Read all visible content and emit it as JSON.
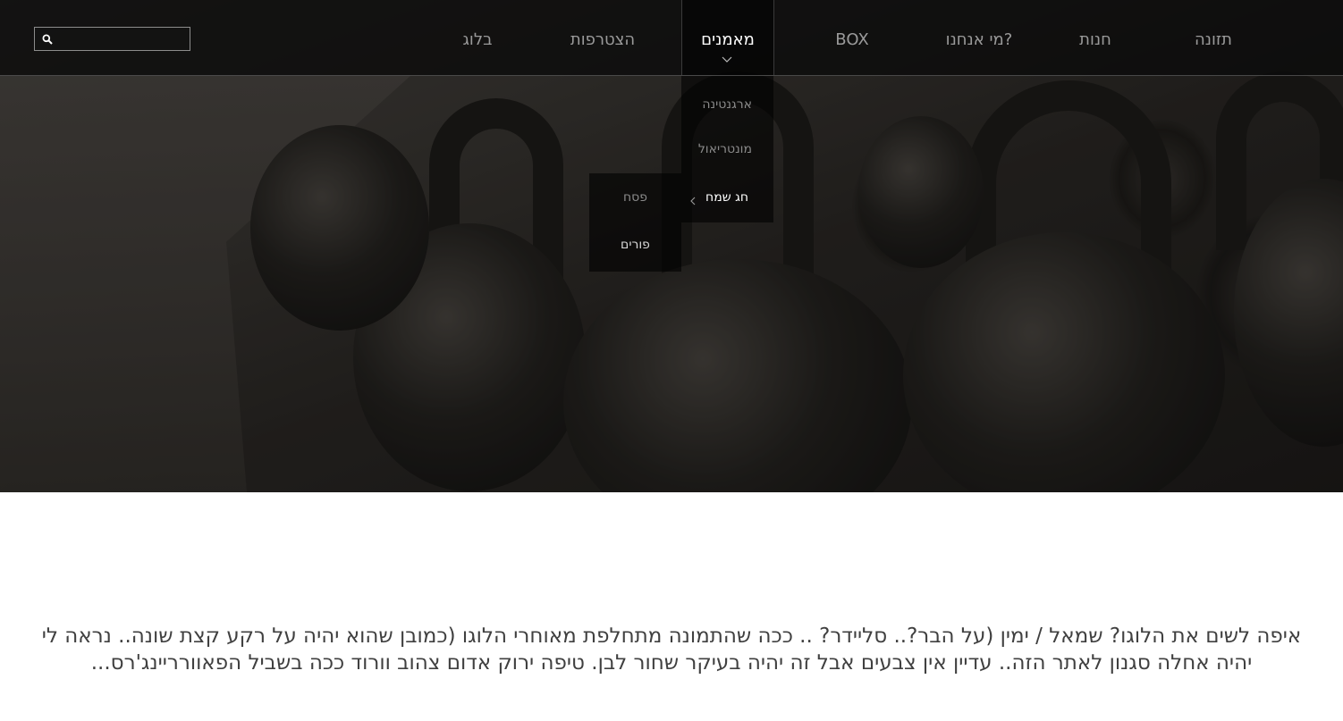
{
  "search": {
    "placeholder": ""
  },
  "nav": {
    "items": [
      {
        "label": "תזונה"
      },
      {
        "label": "חנות"
      },
      {
        "label": "מי אנחנו?"
      },
      {
        "label": "BOX"
      },
      {
        "label": "מאמנים",
        "active": true
      },
      {
        "label": "הצטרפות"
      },
      {
        "label": "בלוג"
      }
    ]
  },
  "dropdown": {
    "items": [
      {
        "label": "ארגנטינה"
      },
      {
        "label": "מונטריאול"
      },
      {
        "label": "חג שמח",
        "has_submenu": true
      }
    ],
    "submenu": [
      {
        "label": "פסח"
      },
      {
        "label": "פורים"
      }
    ]
  },
  "content": {
    "paragraph": "איפה לשים את הלוגו? שמאל / ימין (על הבר?.. סליידר? .. ככה שהתמונה מתחלפת מאוחרי הלוגו (כמובן שהוא יהיה על רקע קצת שונה.. נראה לי יהיה אחלה סגנון לאתר הזה.. עדיין אין צבעים אבל זה יהיה בעיקר שחור לבן. טיפה ירוק אדום צהוב וורוד ככה בשביל הפאוורריינג'רס..."
  }
}
